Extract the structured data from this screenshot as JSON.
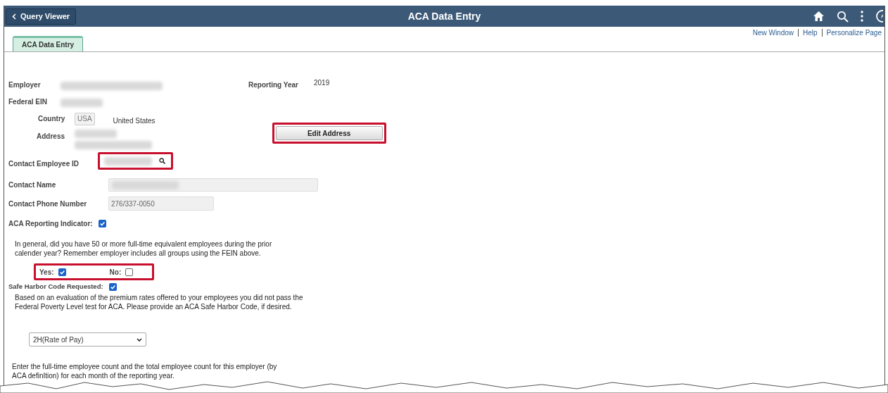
{
  "header": {
    "back_button": "Query Viewer",
    "title": "ACA Data Entry"
  },
  "links": [
    "New Window",
    "Help",
    "Personalize Page"
  ],
  "tabs": [
    {
      "label": "ACA Data Entry",
      "selected": true
    }
  ],
  "employer": {
    "label": "Employer",
    "ein_label": "Federal EIN",
    "reporting_year_label": "Reporting Year",
    "reporting_year": "2019",
    "country_label": "Country",
    "country_code": "USA",
    "country_name": "United States",
    "address_label": "Address",
    "edit_address_button": "Edit Address"
  },
  "contact": {
    "employee_id_label": "Contact Employee ID",
    "name_label": "Contact Name",
    "phone_label": "Contact Phone Number",
    "phone": "276/337-0050"
  },
  "aca_indicator": {
    "label": "ACA Reporting Indicator:",
    "checked": true
  },
  "question": "In general, did you have 50 or more full-time equivalent employees during the prior calender year? Remember employer includes all groups using the FEIN above.",
  "answers": [
    {
      "label": "Yes:",
      "checked": true
    },
    {
      "label": "No:",
      "checked": false
    }
  ],
  "safe_harbor": {
    "label": "Safe Harbor Code Requested:",
    "checked": true,
    "note": "Based on an evaluation of the premium rates offered to your employees you did not pass the Federal Poverty Level test for ACA. Please provide an ACA Safe Harbor Code, if desired.",
    "code": "2H(Rate of Pay)"
  },
  "count_instructions": "Enter the full-time employee count and the total employee count for this employer (by ACA definItion) for each month of the reporting year."
}
